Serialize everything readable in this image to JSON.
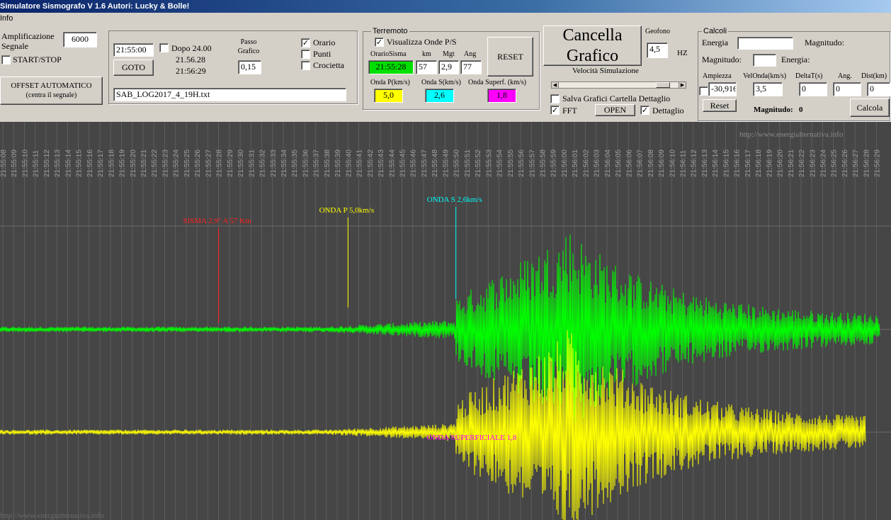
{
  "window": {
    "title": "Simulatore Sismografo V 1.6  Autori: Lucky & Bolle!"
  },
  "menu": {
    "items": [
      "Info"
    ]
  },
  "left_panel": {
    "amplification_label": "Amplificazione\nSegnale",
    "amplification_value": "6000",
    "start_stop_label": "START/STOP",
    "start_stop_checked": false,
    "offset_button_line1": "OFFSET AUTOMATICO",
    "offset_button_line2": "(centra il segnale)"
  },
  "time_panel": {
    "time_value": "21:55:00",
    "goto_label": "GOTO",
    "dopo_label": "Dopo 24.00",
    "dopo_checked": false,
    "time_a": "21.56.28",
    "time_b": "21:56:29",
    "passo_label": "Passo\nGrafico",
    "passo_value": "0,15",
    "orario_label": "Orario",
    "orario_checked": true,
    "punti_label": "Punti",
    "punti_checked": false,
    "crocietta_label": "Crocietta",
    "crocietta_checked": false,
    "file_value": "SAB_LOG2017_4_19H.txt"
  },
  "terremoto": {
    "title": "Terremoto",
    "visualizza_label": "Visualizza Onde P/S",
    "visualizza_checked": true,
    "col_orario": "OrarioSisma",
    "col_km": "km",
    "col_mgt": "Mgt",
    "col_ang": "Ang",
    "orario_value": "21:55:28",
    "km_value": "57",
    "mgt_value": "2,9",
    "ang_value": "77",
    "reset_label": "RESET",
    "onda_p_label": "Onda P(km/s)",
    "onda_s_label": "Onda S(km/s)",
    "onda_superf_label": "Onda Superf. (km/s)",
    "onda_p_value": "5,0",
    "onda_s_value": "2,6",
    "onda_superf_value": "1,8",
    "colors": {
      "orario": "#00e000",
      "p": "#ffff00",
      "s": "#00ffff",
      "superf": "#ff00ff"
    }
  },
  "cancella": {
    "button_line1": "Cancella",
    "button_line2": "Grafico",
    "geofono_label": "Geofono",
    "geofono_value": "4,5",
    "hz_label": "HZ",
    "velocita_label": "Velocità Simulazione",
    "slider_level": 0.92,
    "salva_label": "Salva Grafici Cartella Dettaglio",
    "salva_checked": false,
    "fft_label": "FFT",
    "fft_checked": true,
    "open_label": "OPEN",
    "dettaglio_label": "Dettaglio",
    "dettaglio_checked": true
  },
  "calcoli": {
    "title": "Calcoli",
    "energia_label": "Energia",
    "magnitudo_label1": "Magnitudo:",
    "magnitudo_label2": "Magnitudo:",
    "energia_label2": "Energia:",
    "col_ampiezza": "Ampiezza",
    "col_velonda": "VelOnda(km/s)",
    "col_deltat": "DeltaT(s)",
    "col_ang": "Ang.",
    "col_dist": "Dist(km)",
    "ampiezza_value": "-30,916",
    "velonda_value": "3,5",
    "deltat_value": "0",
    "ang_value": "0",
    "dist_value": "0",
    "reset_label": "Reset",
    "magnitudo_result_label": "Magnitudo:",
    "magnitudo_result_value": "0",
    "calcola_label": "Calcola"
  },
  "chart": {
    "watermark_top": "http://www.energialternativa.info",
    "watermark_bottom": "http://www.energialternativa.info",
    "time_ticks": [
      "21:55:08",
      "21:55:09",
      "21:55:10",
      "21:55:11",
      "21:55:12",
      "21:55:13",
      "21:55:14",
      "21:55:15",
      "21:55:16",
      "21:55:17",
      "21:55:18",
      "21:55:19",
      "21:55:20",
      "21:55:21",
      "21:55:22",
      "21:55:23",
      "21:55:24",
      "21:55:25",
      "21:55:26",
      "21:55:27",
      "21:55:28",
      "21:55:29",
      "21:55:30",
      "21:55:31",
      "21:55:32",
      "21:55:33",
      "21:55:34",
      "21:55:35",
      "21:55:36",
      "21:55:37",
      "21:55:38",
      "21:55:39",
      "21:55:40",
      "21:55:41",
      "21:55:42",
      "21:55:43",
      "21:55:44",
      "21:55:45",
      "21:55:46",
      "21:55:47",
      "21:55:48",
      "21:55:49",
      "21:55:50",
      "21:55:51",
      "21:55:52",
      "21:55:53",
      "21:55:54",
      "21:55:55",
      "21:55:56",
      "21:55:57",
      "21:55:58",
      "21:55:59",
      "21:56:00",
      "21:56:01",
      "21:56:02",
      "21:56:03",
      "21:56:04",
      "21:56:05",
      "21:56:06",
      "21:56:07",
      "21:56:08",
      "21:56:09",
      "21:56:10",
      "21:56:11",
      "21:56:12",
      "21:56:13",
      "21:56:14",
      "21:56:15",
      "21:56:16",
      "21:56:17",
      "21:56:18",
      "21:56:19",
      "21:56:20",
      "21:56:21",
      "21:56:22",
      "21:56:23",
      "21:56:24",
      "21:56:25",
      "21:56:26",
      "21:56:27",
      "21:56:28",
      "21:56:29"
    ],
    "markers": [
      {
        "label": "SISMA 2,9° A 57 Km",
        "color": "#ff2020",
        "time": "21:55:28"
      },
      {
        "label": "ONDA P 5,0km/s",
        "color": "#ffff00",
        "time": "21:55:40"
      },
      {
        "label": "ONDA S 2,6km/s",
        "color": "#00ffff",
        "time": "21:55:50"
      },
      {
        "label": "ONDA SUPERFICIALE 1,8",
        "color": "#ff00ff",
        "time": "21:55:49"
      }
    ],
    "traces": [
      {
        "name": "green",
        "color": "#00ff00"
      },
      {
        "name": "yellow",
        "color": "#ffff00"
      }
    ]
  }
}
